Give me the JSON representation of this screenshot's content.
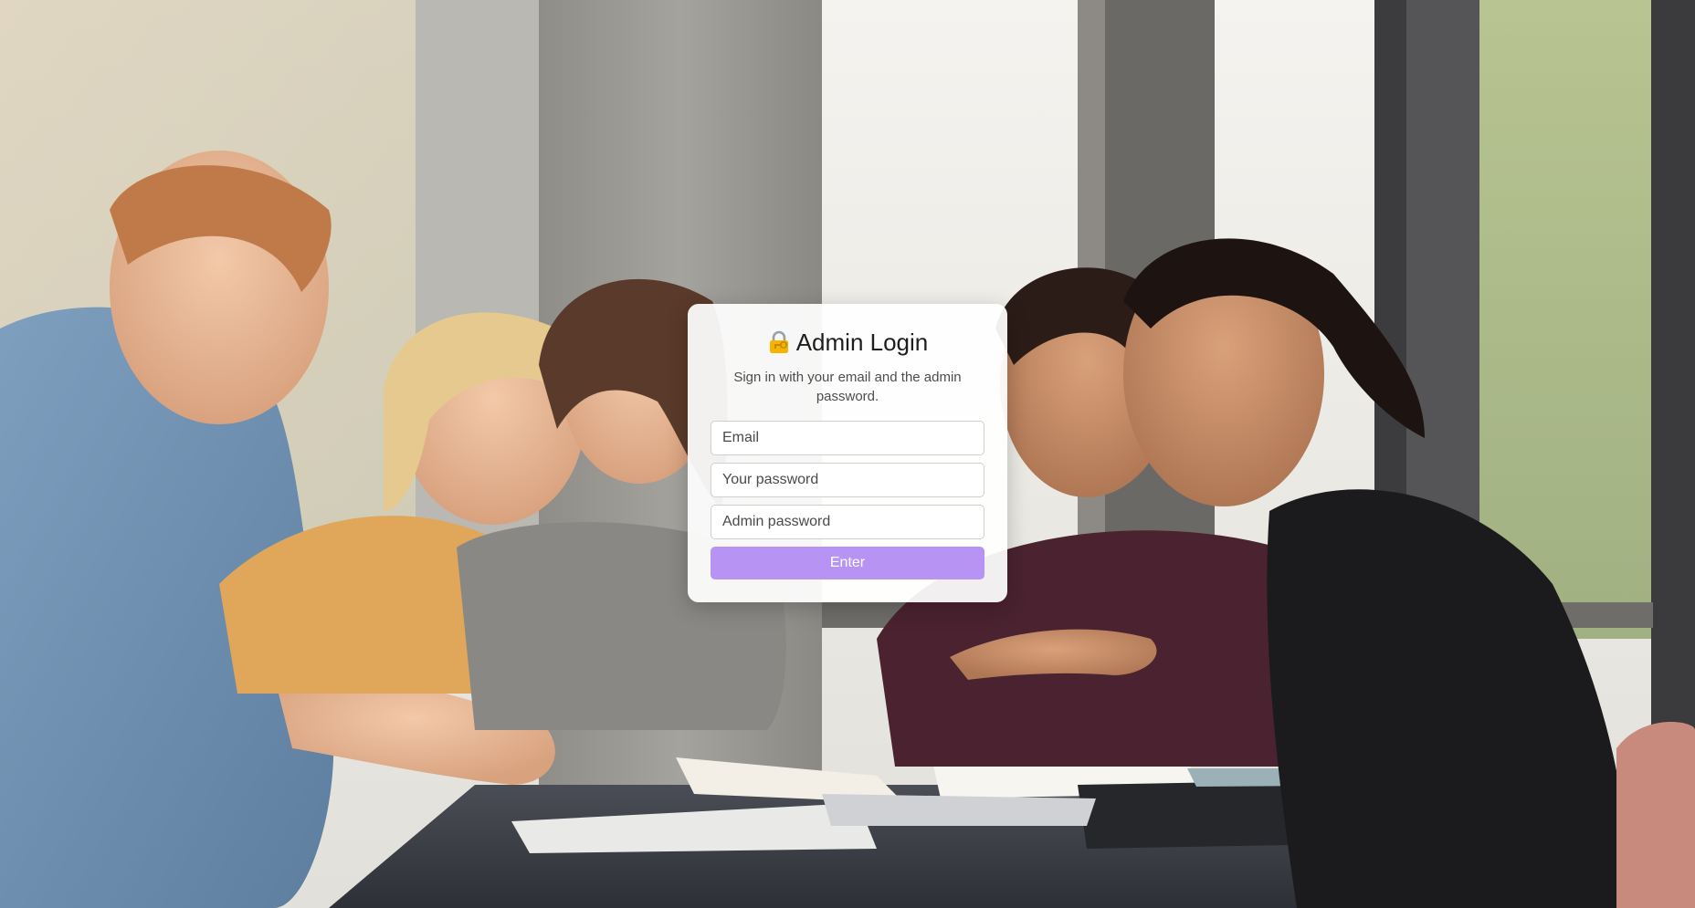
{
  "login": {
    "title": "Admin Login",
    "title_icon": "lock-key-icon",
    "subtitle": "Sign in with your email and the admin password.",
    "fields": {
      "email": {
        "placeholder": "Email",
        "value": ""
      },
      "password": {
        "placeholder": "Your password",
        "value": ""
      },
      "admin_password": {
        "placeholder": "Admin password",
        "value": ""
      }
    },
    "submit_label": "Enter"
  },
  "colors": {
    "accent": "#b794f4",
    "card_bg": "#ffffff",
    "title_text": "#1e1e1e",
    "subtitle_text": "#4d4d4d"
  },
  "background": {
    "description_icon": "students-study-photo"
  }
}
